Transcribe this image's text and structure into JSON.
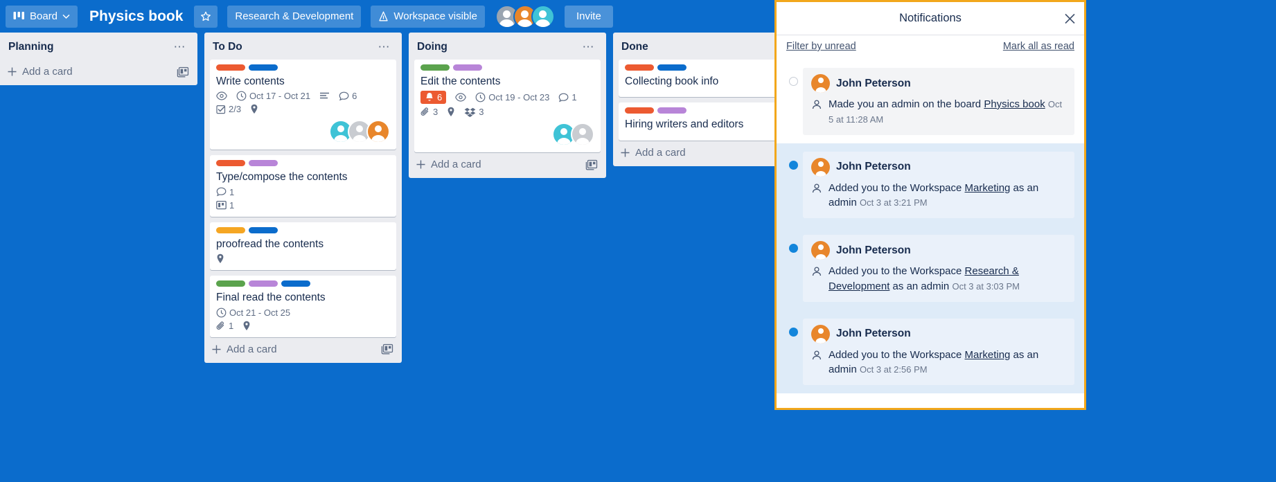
{
  "topbar": {
    "board_button": "Board",
    "board_icon": "board-icon",
    "chevron_icon": "chevron-down-icon",
    "title": "Physics book",
    "star_icon": "star-icon",
    "workspace_name": "Research & Development",
    "visibility_label": "Workspace visible",
    "visibility_icon": "workspace-visible-icon",
    "invite_label": "Invite",
    "avatar_colors": [
      "#9aa5b1",
      "#e8862b",
      "#3fc3d6"
    ]
  },
  "colors": {
    "board_bg": "#0b6ccc",
    "list_bg": "#ebecf0",
    "accent_orange": "#ec5a31",
    "notif_border": "#f2a71b",
    "unread_dot": "#1285db",
    "unread_row_bg": "#deebf8"
  },
  "lists": [
    {
      "title": "Planning",
      "menu_icon": "list-menu-icon",
      "add_card_label": "Add a card",
      "add_card_icon": "plus-icon",
      "template_icon": "card-template-icon",
      "cards": []
    },
    {
      "title": "To Do",
      "menu_icon": "list-menu-icon",
      "add_card_label": "Add a card",
      "add_card_icon": "plus-icon",
      "template_icon": "card-template-icon",
      "cards": [
        {
          "labels": [
            "#ec5a31",
            "#0b6ccc"
          ],
          "title": "Write contents",
          "watch_icon": "eye-icon",
          "due": "Oct 17 - Oct 21",
          "description_icon": "description-icon",
          "comments": "6",
          "checklist": "2/3",
          "location_icon": "location-icon",
          "members": [
            "#3fc3d6",
            "#c9ccd1",
            "#e8862b"
          ]
        },
        {
          "labels": [
            "#ec5a31",
            "#b885d8"
          ],
          "title": "Type/compose the contents",
          "comments": "1",
          "attachments_board": "1",
          "members": []
        },
        {
          "labels": [
            "#f5a623",
            "#0b6ccc"
          ],
          "title": "proofread the contents",
          "location_icon": "location-icon",
          "members": []
        },
        {
          "labels": [
            "#5ba34d",
            "#b885d8",
            "#0b6ccc"
          ],
          "title": "Final read the contents",
          "due": "Oct 21 - Oct 25",
          "attachments": "1",
          "location_icon": "location-icon",
          "members": []
        }
      ]
    },
    {
      "title": "Doing",
      "menu_icon": "list-menu-icon",
      "add_card_label": "Add a card",
      "add_card_icon": "plus-icon",
      "template_icon": "card-template-icon",
      "cards": [
        {
          "labels": [
            "#5ba34d",
            "#b885d8"
          ],
          "title": "Edit the contents",
          "due_badge": "6",
          "due_badge_icon": "bell-icon",
          "watch_icon": "eye-icon",
          "due": "Oct 19 - Oct 23",
          "comments": "1",
          "attachments": "3",
          "location_icon": "location-icon",
          "dropbox": "3",
          "members": [
            "#3fc3d6",
            "#c9ccd1"
          ]
        }
      ]
    },
    {
      "title": "Done",
      "menu_icon": "list-menu-icon",
      "add_card_label": "Add a card",
      "add_card_icon": "plus-icon",
      "cards": [
        {
          "labels": [
            "#ec5a31",
            "#0b6ccc"
          ],
          "title": "Collecting book info",
          "members": []
        },
        {
          "labels": [
            "#ec5a31",
            "#b885d8"
          ],
          "title": "Hiring writers and editors",
          "members": []
        }
      ]
    }
  ],
  "notifications": {
    "title": "Notifications",
    "close_icon": "close-icon",
    "filter_label": "Filter by unread",
    "mark_all_label": "Mark all as read",
    "items": [
      {
        "unread": false,
        "user": "John Peterson",
        "action_icon": "member-icon",
        "text_before": "Made you an admin on the board ",
        "link": "Physics book",
        "text_after": "",
        "time": "Oct 5 at 11:28 AM"
      },
      {
        "unread": true,
        "user": "John Peterson",
        "action_icon": "member-icon",
        "text_before": "Added you to the Workspace ",
        "link": "Marketing",
        "text_after": " as an admin",
        "time": "Oct 3 at 3:21 PM"
      },
      {
        "unread": true,
        "user": "John Peterson",
        "action_icon": "member-icon",
        "text_before": "Added you to the Workspace ",
        "link": "Research & Development",
        "text_after": " as an admin",
        "time": "Oct 3 at 3:03 PM"
      },
      {
        "unread": true,
        "user": "John Peterson",
        "action_icon": "member-icon",
        "text_before": "Added you to the Workspace ",
        "link": "Marketing",
        "text_after": " as an admin",
        "time": "Oct 3 at 2:56 PM"
      }
    ]
  }
}
